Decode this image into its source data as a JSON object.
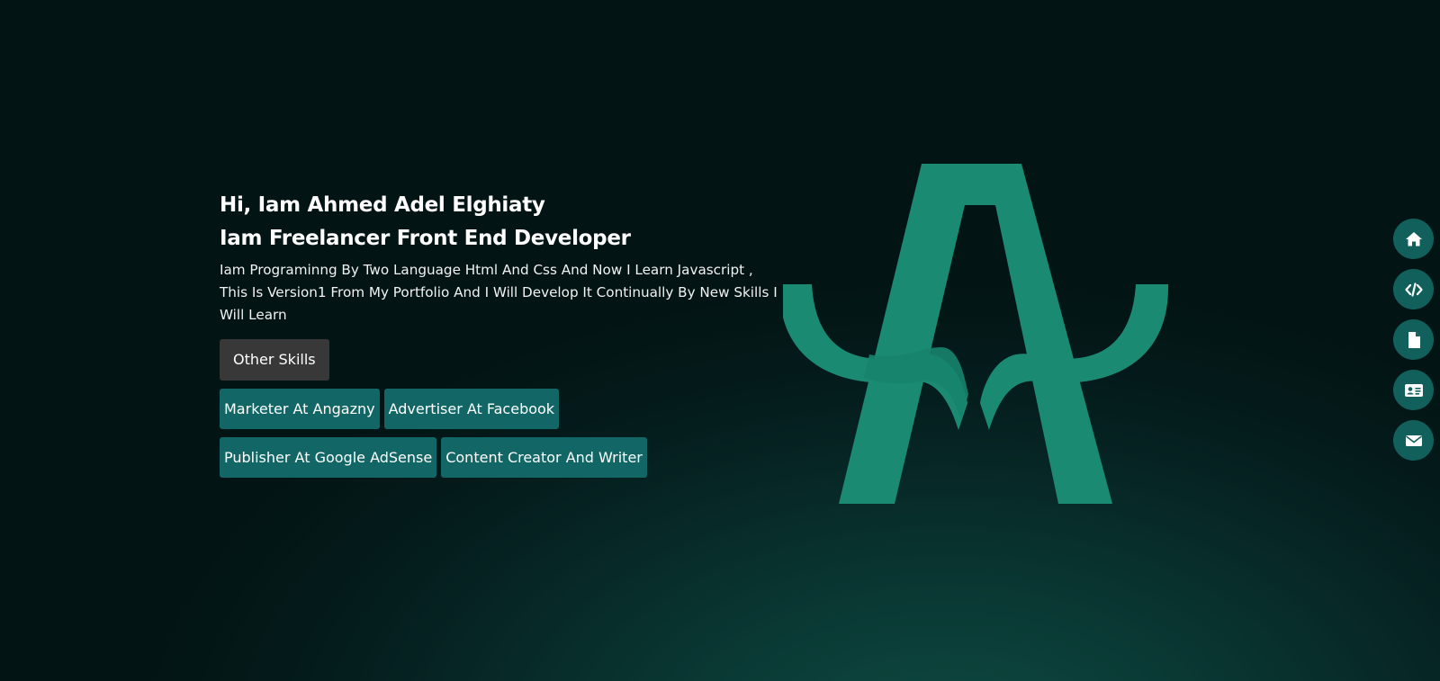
{
  "hero": {
    "greeting": "Hi, Iam Ahmed Adel Elghiaty",
    "role": "Iam Freelancer Front End Developer",
    "intro": "Iam Programinng By Two Language Html And Css And Now I Learn Javascript , This Is Version1 From My Portfolio And I Will Develop It Continually By New Skills I Will Learn",
    "other_skills_label": "Other Skills",
    "skills": [
      "Marketer At Angazny",
      "Advertiser At Facebook",
      "Publisher At Google AdSense",
      "Content Creator And Writer"
    ]
  },
  "logo": {
    "letter": "A",
    "color": "#1a8a73"
  },
  "side_nav": [
    {
      "icon": "home-icon"
    },
    {
      "icon": "code-icon"
    },
    {
      "icon": "file-icon"
    },
    {
      "icon": "id-card-icon"
    },
    {
      "icon": "envelope-icon"
    }
  ],
  "colors": {
    "accent": "#126766",
    "button_dark": "#383838",
    "logo": "#1a8a73",
    "nav_button": "#12605c"
  }
}
